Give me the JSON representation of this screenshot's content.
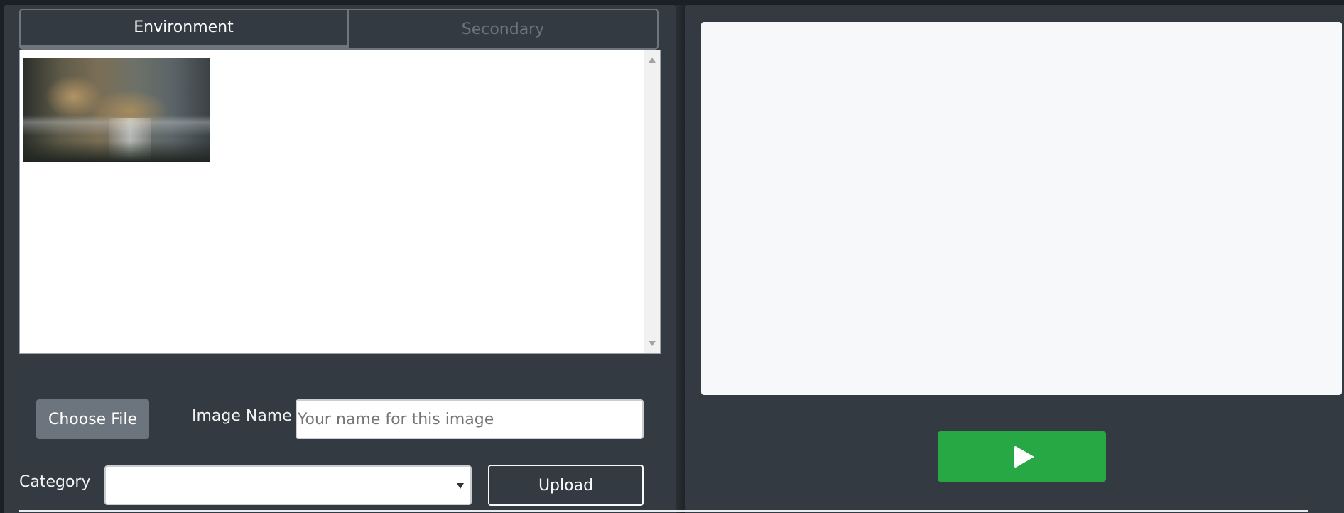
{
  "tabs": [
    {
      "label": "Environment",
      "active": true
    },
    {
      "label": "Secondary",
      "active": false
    }
  ],
  "gallery": {
    "items": [
      {
        "icon": "landscape-thumbnail"
      }
    ]
  },
  "form": {
    "choose_file_label": "Choose File",
    "image_name_label": "Image Name",
    "image_name_placeholder": "Your name for this image",
    "image_name_value": "",
    "category_label": "Category",
    "category_value": "",
    "upload_label": "Upload"
  },
  "player": {
    "play_icon": "play-icon"
  },
  "colors": {
    "panel": "#343a42",
    "play_button": "#28a745",
    "choose_button": "#6c747d",
    "preview_bg": "#f7f8fa"
  }
}
